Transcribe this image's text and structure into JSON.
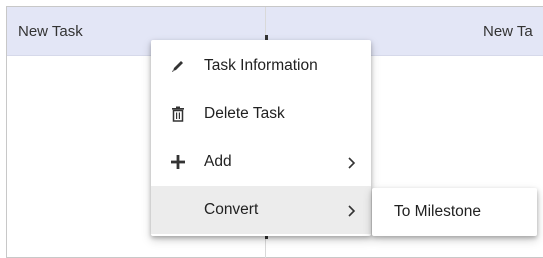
{
  "grid": {
    "left_task_label": "New Task",
    "right_task_label": "New Ta"
  },
  "context_menu": {
    "items": [
      {
        "label": "Task Information",
        "icon": "pencil-icon"
      },
      {
        "label": "Delete Task",
        "icon": "trash-icon"
      },
      {
        "label": "Add",
        "icon": "plus-icon",
        "submenu_arrow": "chevron-right-icon"
      },
      {
        "label": "Convert",
        "icon": "",
        "submenu_arrow": "chevron-right-icon",
        "active": true
      }
    ]
  },
  "submenu": {
    "items": [
      {
        "label": "To Milestone"
      }
    ]
  },
  "colors": {
    "header_background": "#e3e6f6",
    "menu_active_background": "#ececec",
    "text": "#212121"
  }
}
